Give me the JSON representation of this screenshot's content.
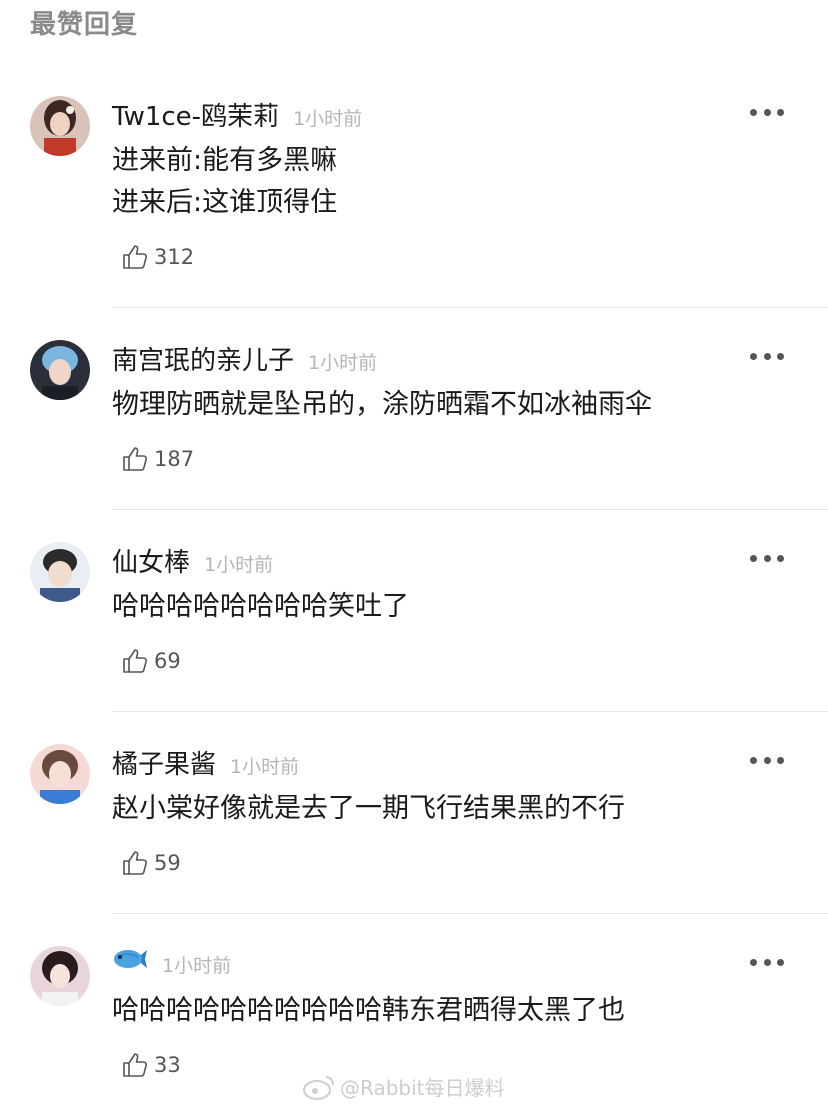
{
  "section_title": "最赞回复",
  "comments": [
    {
      "username": "Tw1ce-鸥茉莉",
      "time": "1小时前",
      "lines": [
        "进来前:能有多黑嘛",
        "进来后:这谁顶得住"
      ],
      "likes": "312"
    },
    {
      "username": "南宫珉的亲儿子",
      "time": "1小时前",
      "lines": [
        "物理防晒就是坠吊的，涂防晒霜不如冰袖雨伞"
      ],
      "likes": "187"
    },
    {
      "username": "仙女棒",
      "time": "1小时前",
      "lines": [
        "哈哈哈哈哈哈哈哈笑吐了"
      ],
      "likes": "69"
    },
    {
      "username": "橘子果酱",
      "time": "1小时前",
      "lines": [
        "赵小棠好像就是去了一期飞行结果黑的不行"
      ],
      "likes": "59"
    },
    {
      "username": "",
      "username_icon": "fish-icon",
      "time": "1小时前",
      "lines": [
        "哈哈哈哈哈哈哈哈哈哈韩东君晒得太黑了也"
      ],
      "likes": "33"
    }
  ],
  "watermark": "@Rabbit每日爆料",
  "colors": {
    "background": "#ffffff",
    "muted": "#b5b5b5",
    "divider": "#e6e6e6"
  }
}
